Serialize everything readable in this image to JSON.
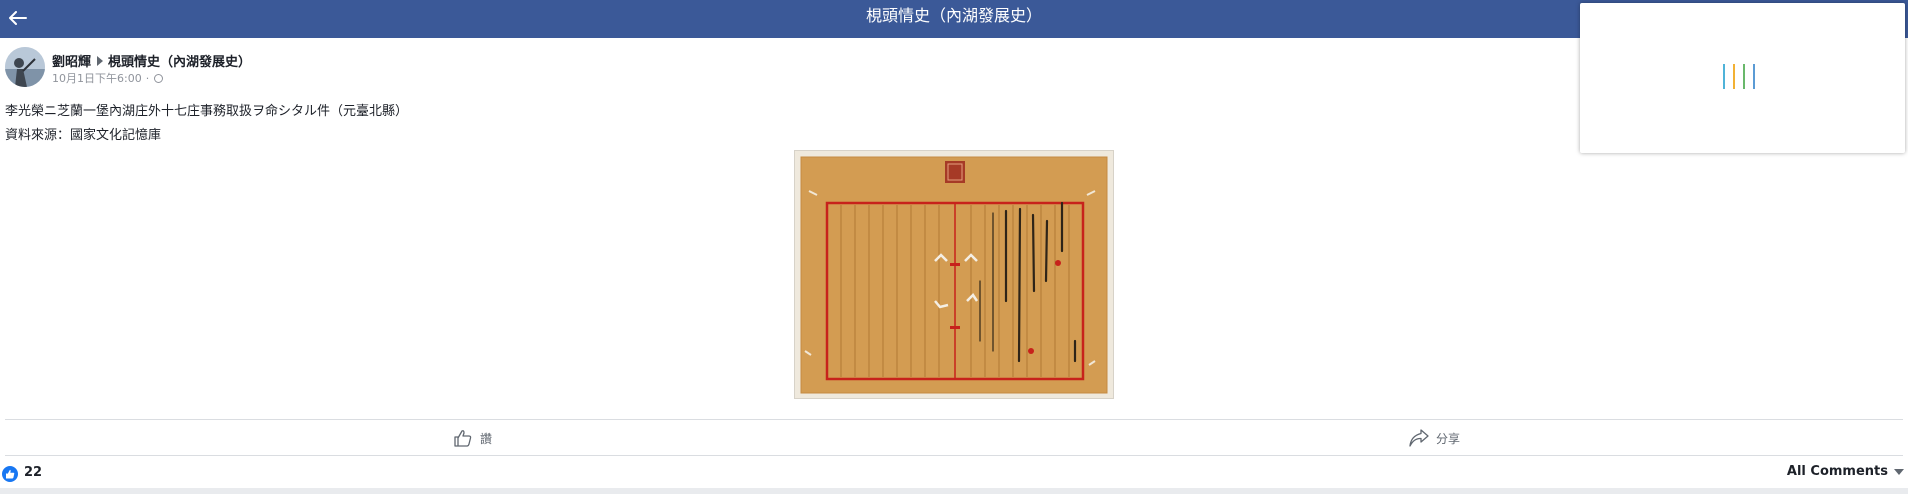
{
  "header": {
    "title": "梘頭情史（內湖發展史）",
    "back_icon": "arrow-left-icon",
    "bg_color": "#3b5998"
  },
  "post": {
    "author": "劉昭輝",
    "group": "梘頭情史（內湖發展史）",
    "timestamp": "10月1日下午6:00",
    "privacy_icon": "globe-icon",
    "text_lines": [
      "李光榮ニ芝蘭一堡內湖庄外十七庄事務取扱ヲ命シタル件（元臺北縣）",
      "資料來源：國家文化記憶庫"
    ]
  },
  "actions": {
    "like_label": "讚",
    "share_label": "分享"
  },
  "footer": {
    "like_count": "22",
    "comments_filter": "All Comments"
  },
  "colors": {
    "accent": "#3b5998",
    "like_blue": "#1877f2"
  }
}
